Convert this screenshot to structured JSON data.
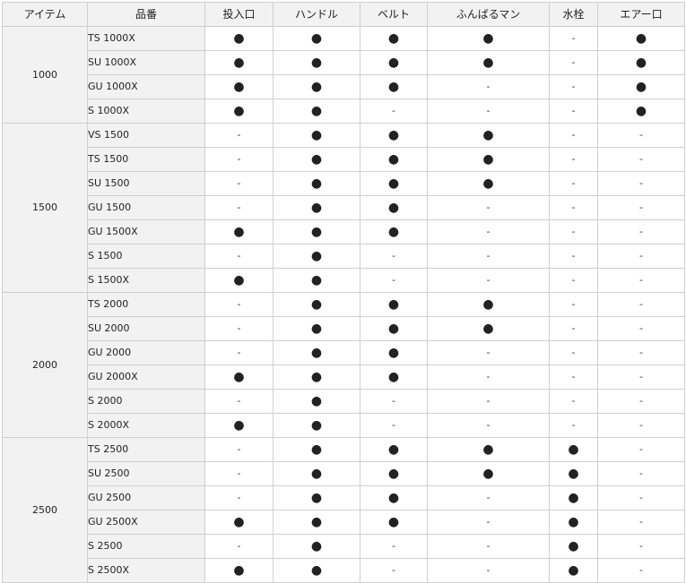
{
  "table": {
    "headers": [
      "アイテム",
      "品番",
      "投入口",
      "ハンドル",
      "ベルト",
      "ふんばるマン",
      "水栓",
      "エアー口"
    ],
    "marks": {
      "yes": "●",
      "no": "-"
    },
    "groups": [
      {
        "item": "1000",
        "rows": [
          {
            "model": "TS 1000X",
            "features": [
              "yes",
              "yes",
              "yes",
              "yes",
              "no",
              "yes"
            ]
          },
          {
            "model": "SU 1000X",
            "features": [
              "yes",
              "yes",
              "yes",
              "yes",
              "no",
              "yes"
            ]
          },
          {
            "model": "GU 1000X",
            "features": [
              "yes",
              "yes",
              "yes",
              "no",
              "no",
              "yes"
            ]
          },
          {
            "model": "S 1000X",
            "features": [
              "yes",
              "yes",
              "no",
              "no",
              "no",
              "yes"
            ]
          }
        ]
      },
      {
        "item": "1500",
        "rows": [
          {
            "model": "VS 1500",
            "features": [
              "no",
              "yes",
              "yes",
              "yes",
              "no",
              "no"
            ]
          },
          {
            "model": "TS 1500",
            "features": [
              "no",
              "yes",
              "yes",
              "yes",
              "no",
              "no"
            ]
          },
          {
            "model": "SU 1500",
            "features": [
              "no",
              "yes",
              "yes",
              "yes",
              "no",
              "no"
            ]
          },
          {
            "model": "GU 1500",
            "features": [
              "no",
              "yes",
              "yes",
              "no",
              "no",
              "no"
            ]
          },
          {
            "model": "GU 1500X",
            "features": [
              "yes",
              "yes",
              "yes",
              "no",
              "no",
              "no"
            ]
          },
          {
            "model": "S 1500",
            "features": [
              "no",
              "yes",
              "no",
              "no",
              "no",
              "no"
            ]
          },
          {
            "model": "S 1500X",
            "features": [
              "yes",
              "yes",
              "no",
              "no",
              "no",
              "no"
            ]
          }
        ]
      },
      {
        "item": "2000",
        "rows": [
          {
            "model": "TS 2000",
            "features": [
              "no",
              "yes",
              "yes",
              "yes",
              "no",
              "no"
            ]
          },
          {
            "model": "SU 2000",
            "features": [
              "no",
              "yes",
              "yes",
              "yes",
              "no",
              "no"
            ]
          },
          {
            "model": "GU 2000",
            "features": [
              "no",
              "yes",
              "yes",
              "no",
              "no",
              "no"
            ]
          },
          {
            "model": "GU 2000X",
            "features": [
              "yes",
              "yes",
              "yes",
              "no",
              "no",
              "no"
            ]
          },
          {
            "model": "S 2000",
            "features": [
              "no",
              "yes",
              "no",
              "no",
              "no",
              "no"
            ]
          },
          {
            "model": "S 2000X",
            "features": [
              "yes",
              "yes",
              "no",
              "no",
              "no",
              "no"
            ]
          }
        ]
      },
      {
        "item": "2500",
        "rows": [
          {
            "model": "TS 2500",
            "features": [
              "no",
              "yes",
              "yes",
              "yes",
              "yes",
              "no"
            ]
          },
          {
            "model": "SU 2500",
            "features": [
              "no",
              "yes",
              "yes",
              "yes",
              "yes",
              "no"
            ]
          },
          {
            "model": "GU 2500",
            "features": [
              "no",
              "yes",
              "yes",
              "no",
              "yes",
              "no"
            ]
          },
          {
            "model": "GU 2500X",
            "features": [
              "yes",
              "yes",
              "yes",
              "no",
              "yes",
              "no"
            ]
          },
          {
            "model": "S 2500",
            "features": [
              "no",
              "yes",
              "no",
              "no",
              "yes",
              "no"
            ]
          },
          {
            "model": "S 2500X",
            "features": [
              "yes",
              "yes",
              "no",
              "no",
              "yes",
              "no"
            ]
          }
        ]
      }
    ]
  }
}
